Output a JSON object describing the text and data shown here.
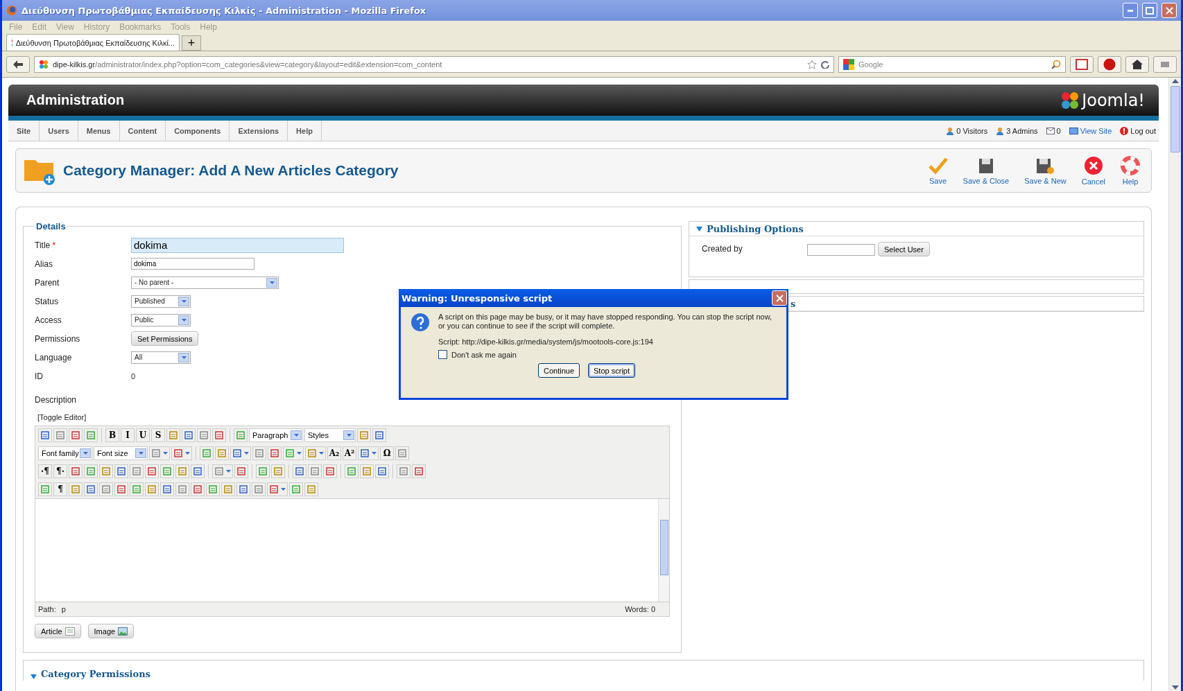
{
  "window": {
    "title": "Διεύθυνση Πρωτοβάθμιας Εκπαίδευσης Κιλκίς - Administration - Mozilla Firefox"
  },
  "menubar": [
    "File",
    "Edit",
    "View",
    "History",
    "Bookmarks",
    "Tools",
    "Help"
  ],
  "tabs": [
    {
      "title": "Διεύθυνση Πρωτοβάθμιας Εκπαίδευσης Κιλκί...",
      "selected": true
    }
  ],
  "new_tab": "+",
  "address": {
    "host": "dipe-kilkis.gr",
    "path": "/administrator/index.php?option=com_categories&view=category&layout=edit&extension=com_content"
  },
  "search": {
    "placeholder": "Google"
  },
  "header": {
    "title": "Administration",
    "logo": "Joomla!"
  },
  "admin_menu": [
    "Site",
    "Users",
    "Menus",
    "Content",
    "Components",
    "Extensions",
    "Help"
  ],
  "status": [
    {
      "kind": "visitors",
      "label": "0 Visitors"
    },
    {
      "kind": "admins",
      "label": "3 Admins"
    },
    {
      "kind": "messages",
      "label": "0"
    },
    {
      "kind": "view",
      "label": "View Site"
    },
    {
      "kind": "logout",
      "label": "Log out"
    }
  ],
  "toolbar": {
    "title": "Category Manager: Add A New Articles Category",
    "buttons": [
      {
        "kind": "save",
        "label": "Save"
      },
      {
        "kind": "save-close",
        "label": "Save & Close"
      },
      {
        "kind": "save-new",
        "label": "Save & New"
      },
      {
        "kind": "cancel",
        "label": "Cancel"
      },
      {
        "kind": "help",
        "label": "Help"
      }
    ]
  },
  "details": {
    "legend": "Details",
    "fields": [
      {
        "kind": "text",
        "label": "Title",
        "required_mark": "*",
        "value": "dokima"
      },
      {
        "kind": "input",
        "label": "Alias",
        "value": "dokima"
      },
      {
        "kind": "wide-select",
        "label": "Parent",
        "value": "- No parent -"
      },
      {
        "kind": "select",
        "label": "Status",
        "value": "Published"
      },
      {
        "kind": "select",
        "label": "Access",
        "value": "Public"
      },
      {
        "kind": "button",
        "label": "Permissions",
        "value": "Set Permissions"
      },
      {
        "kind": "select",
        "label": "Language",
        "value": "All"
      },
      {
        "kind": "static",
        "label": "ID",
        "value": "0"
      }
    ],
    "description": "Description",
    "toggle": "[Toggle Editor]",
    "editor": {
      "toolbar_rows": [
        {
          "items": [
            {
              "kind": "icon"
            },
            {
              "kind": "icon"
            },
            {
              "kind": "icon"
            },
            {
              "kind": "icon"
            },
            {
              "kind": "sep"
            },
            {
              "kind": "glyph",
              "label": "B"
            },
            {
              "kind": "glyph",
              "label": "I"
            },
            {
              "kind": "glyph",
              "label": "U"
            },
            {
              "kind": "glyph",
              "label": "S"
            },
            {
              "kind": "icon"
            },
            {
              "kind": "icon"
            },
            {
              "kind": "icon"
            },
            {
              "kind": "icon"
            },
            {
              "kind": "sep"
            },
            {
              "kind": "icon"
            },
            {
              "kind": "select",
              "label": "Paragraph"
            },
            {
              "kind": "select",
              "label": "Styles"
            },
            {
              "kind": "icon"
            },
            {
              "kind": "icon"
            }
          ]
        },
        {
          "items": [
            {
              "kind": "select",
              "label": "Font family"
            },
            {
              "kind": "select",
              "label": "Font size"
            },
            {
              "kind": "split"
            },
            {
              "kind": "split"
            },
            {
              "kind": "sep"
            },
            {
              "kind": "icon"
            },
            {
              "kind": "icon"
            },
            {
              "kind": "split"
            },
            {
              "kind": "icon"
            },
            {
              "kind": "icon"
            },
            {
              "kind": "split"
            },
            {
              "kind": "split"
            },
            {
              "kind": "glyph",
              "label": "A₂"
            },
            {
              "kind": "glyph",
              "label": "A²"
            },
            {
              "kind": "split"
            },
            {
              "kind": "glyph",
              "label": "Ω"
            },
            {
              "kind": "icon"
            }
          ]
        },
        {
          "items": [
            {
              "kind": "glyph",
              "label": "·¶"
            },
            {
              "kind": "glyph",
              "label": "¶·"
            },
            {
              "kind": "icon"
            },
            {
              "kind": "icon"
            },
            {
              "kind": "icon"
            },
            {
              "kind": "icon"
            },
            {
              "kind": "icon"
            },
            {
              "kind": "icon"
            },
            {
              "kind": "icon"
            },
            {
              "kind": "icon"
            },
            {
              "kind": "icon"
            },
            {
              "kind": "sep"
            },
            {
              "kind": "split"
            },
            {
              "kind": "icon"
            },
            {
              "kind": "sep"
            },
            {
              "kind": "icon"
            },
            {
              "kind": "icon"
            },
            {
              "kind": "sep"
            },
            {
              "kind": "icon"
            },
            {
              "kind": "icon"
            },
            {
              "kind": "icon"
            },
            {
              "kind": "sep"
            },
            {
              "kind": "icon"
            },
            {
              "kind": "icon"
            },
            {
              "kind": "icon"
            },
            {
              "kind": "sep"
            },
            {
              "kind": "icon"
            },
            {
              "kind": "icon"
            }
          ]
        },
        {
          "items": [
            {
              "kind": "icon"
            },
            {
              "kind": "glyph",
              "label": "¶"
            },
            {
              "kind": "icon"
            },
            {
              "kind": "icon"
            },
            {
              "kind": "icon"
            },
            {
              "kind": "icon"
            },
            {
              "kind": "icon"
            },
            {
              "kind": "icon"
            },
            {
              "kind": "icon"
            },
            {
              "kind": "icon"
            },
            {
              "kind": "icon"
            },
            {
              "kind": "icon"
            },
            {
              "kind": "icon"
            },
            {
              "kind": "icon"
            },
            {
              "kind": "icon"
            },
            {
              "kind": "split"
            },
            {
              "kind": "icon"
            },
            {
              "kind": "icon"
            }
          ]
        }
      ],
      "path_label": "Path:",
      "path": "p",
      "words": "Words: 0"
    },
    "buttons": [
      {
        "kind": "article",
        "label": "Article"
      },
      {
        "kind": "image",
        "label": "Image"
      }
    ]
  },
  "publishing": {
    "title": "Publishing Options",
    "expanded": true,
    "created_by": "Created by",
    "select_user": "Select User"
  },
  "collapsed_panels": [
    {
      "title": "s"
    }
  ],
  "category_permissions": {
    "title": "Category Permissions",
    "expanded": true
  },
  "dialog": {
    "title": "Warning: Unresponsive script",
    "message": "A script on this page may be busy, or it may have stopped responding. You can stop the script now, or you can continue to see if the script will complete.",
    "script": "Script: http://dipe-kilkis.gr/media/system/js/mootools-core.js:194",
    "checkbox": {
      "label": "Don't ask me again",
      "checked": false
    },
    "buttons": [
      {
        "label": "Continue",
        "selected": false
      },
      {
        "label": "Stop script",
        "selected": true
      }
    ]
  }
}
